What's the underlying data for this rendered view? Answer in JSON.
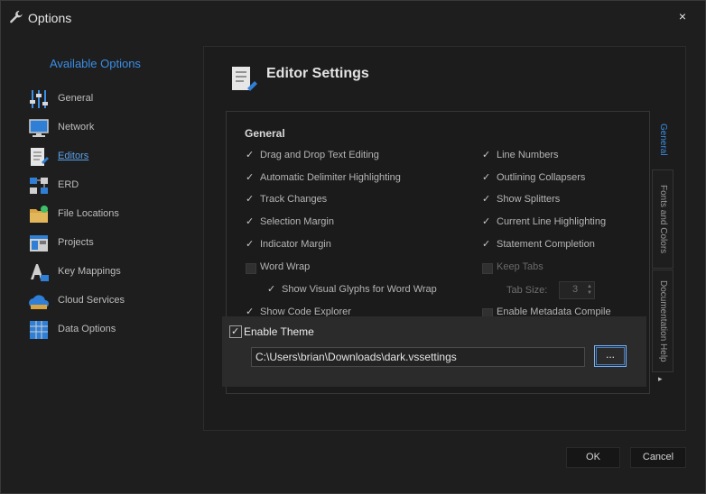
{
  "window": {
    "title": "Options",
    "close_glyph": "×",
    "title_icon": "wrench-icon"
  },
  "sidebar": {
    "title": "Available Options",
    "items": [
      {
        "label": "General",
        "icon": "sliders-icon"
      },
      {
        "label": "Network",
        "icon": "monitor-icon"
      },
      {
        "label": "Editors",
        "icon": "document-icon",
        "active": true
      },
      {
        "label": "ERD",
        "icon": "erd-icon"
      },
      {
        "label": "File Locations",
        "icon": "folder-icon"
      },
      {
        "label": "Projects",
        "icon": "projects-icon"
      },
      {
        "label": "Key Mappings",
        "icon": "keyboard-icon"
      },
      {
        "label": "Cloud Services",
        "icon": "cloud-icon"
      },
      {
        "label": "Data Options",
        "icon": "grid-icon"
      }
    ]
  },
  "editor": {
    "title": "Editor Settings",
    "group_title": "General",
    "left_options": [
      {
        "label": "Drag and Drop Text Editing",
        "checked": true
      },
      {
        "label": "Automatic Delimiter Highlighting",
        "checked": true
      },
      {
        "label": "Track Changes",
        "checked": true
      },
      {
        "label": "Selection Margin",
        "checked": true
      },
      {
        "label": "Indicator Margin",
        "checked": true
      },
      {
        "label": "Word Wrap",
        "checked": false
      },
      {
        "label": "Show Visual Glyphs for Word Wrap",
        "checked": true,
        "indent": true
      },
      {
        "label": "Show Code Explorer",
        "checked": true
      }
    ],
    "right_options": [
      {
        "label": "Line Numbers",
        "checked": true
      },
      {
        "label": "Outlining Collapsers",
        "checked": true
      },
      {
        "label": "Show Splitters",
        "checked": true
      },
      {
        "label": "Current Line Highlighting",
        "checked": true
      },
      {
        "label": "Statement Completion",
        "checked": true
      },
      {
        "label": "Keep Tabs",
        "checked": false,
        "disabled": true
      },
      {
        "label": "Enable Metadata Compile",
        "checked": false
      }
    ],
    "tab_size": {
      "label": "Tab Size:",
      "value": "3"
    },
    "vertical_tabs": [
      "General",
      "Fonts and Colors",
      "Documentation Help"
    ],
    "vertical_tabs_arrow": "▸"
  },
  "theme": {
    "enable_label": "Enable Theme",
    "enabled": true,
    "path": "C:\\Users\\brian\\Downloads\\dark.vssettings",
    "browse_label": "..."
  },
  "buttons": {
    "ok": "OK",
    "cancel": "Cancel"
  },
  "colors": {
    "accent": "#3a8ee6",
    "background": "#1e1e1e"
  }
}
